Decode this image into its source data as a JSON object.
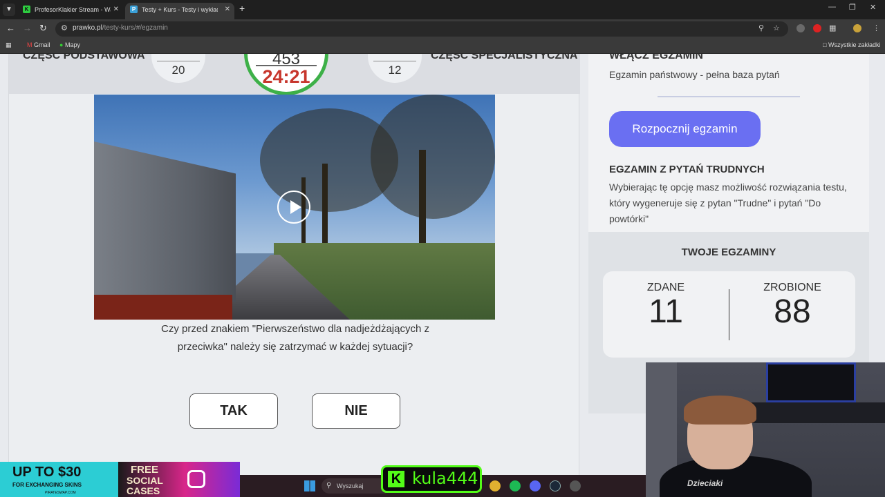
{
  "browser": {
    "tabs": [
      {
        "title": "ProfesorKlakier Stream - Watch",
        "favicon": "K",
        "active": false
      },
      {
        "title": "Testy + Kurs - Testy i wykłady n",
        "favicon": "P",
        "active": true
      }
    ],
    "url_host": "prawko.pl",
    "url_path": "/testy-kurs/#/egzamin",
    "bookmarks": {
      "gmail": "Gmail",
      "maps": "Mapy",
      "all": "Wszystkie zakładki"
    }
  },
  "exam": {
    "section_basic": "CZĘŚĆ PODSTAWOWA",
    "section_specialist": "CZĘŚĆ SPECJALISTYCZNA",
    "basic_count": "20",
    "specialist_count": "12",
    "timer_top": "453",
    "timer_time": "24:21",
    "question": "Czy przed znakiem \"Pierwszeństwo dla nadjeżdżających z przeciwka\" należy się zatrzymać w każdej sytuacji?",
    "answer_yes": "TAK",
    "answer_no": "NIE"
  },
  "sidebar": {
    "heading": "WŁĄCZ EGZAMIN",
    "subheading": "Egzamin państwowy - pełna baza pytań",
    "start_button": "Rozpocznij egzamin",
    "hard_heading": "EGZAMIN Z PYTAŃ TRUDNYCH",
    "hard_desc": "Wybierając tę opcję masz możliwość rozwiązania testu, który wygeneruje się z pytan \"Trudne\" i pytań \"Do powtórki\"",
    "your_exams": "TWOJE EGZAMINY",
    "passed_label": "ZDANE",
    "passed_value": "11",
    "done_label": "ZROBIONE",
    "done_value": "88"
  },
  "overlay": {
    "promo_big": "UP TO $30",
    "promo_small": "FOR EXCHANGING SKINS",
    "promo_site": "PIRATESWAP.COM",
    "promo_free": "FREE",
    "promo_cases": "SOCIAL CASES",
    "kick_logo": "K",
    "kick_user": "kula444",
    "taskbar_search": "Wyszukaj",
    "webcam_print": "Dzieciaki"
  },
  "colors": {
    "accent": "#6a6ff2",
    "timer_ring": "#3db048",
    "timer_text": "#c7362c",
    "kick_green": "#53fc18"
  }
}
